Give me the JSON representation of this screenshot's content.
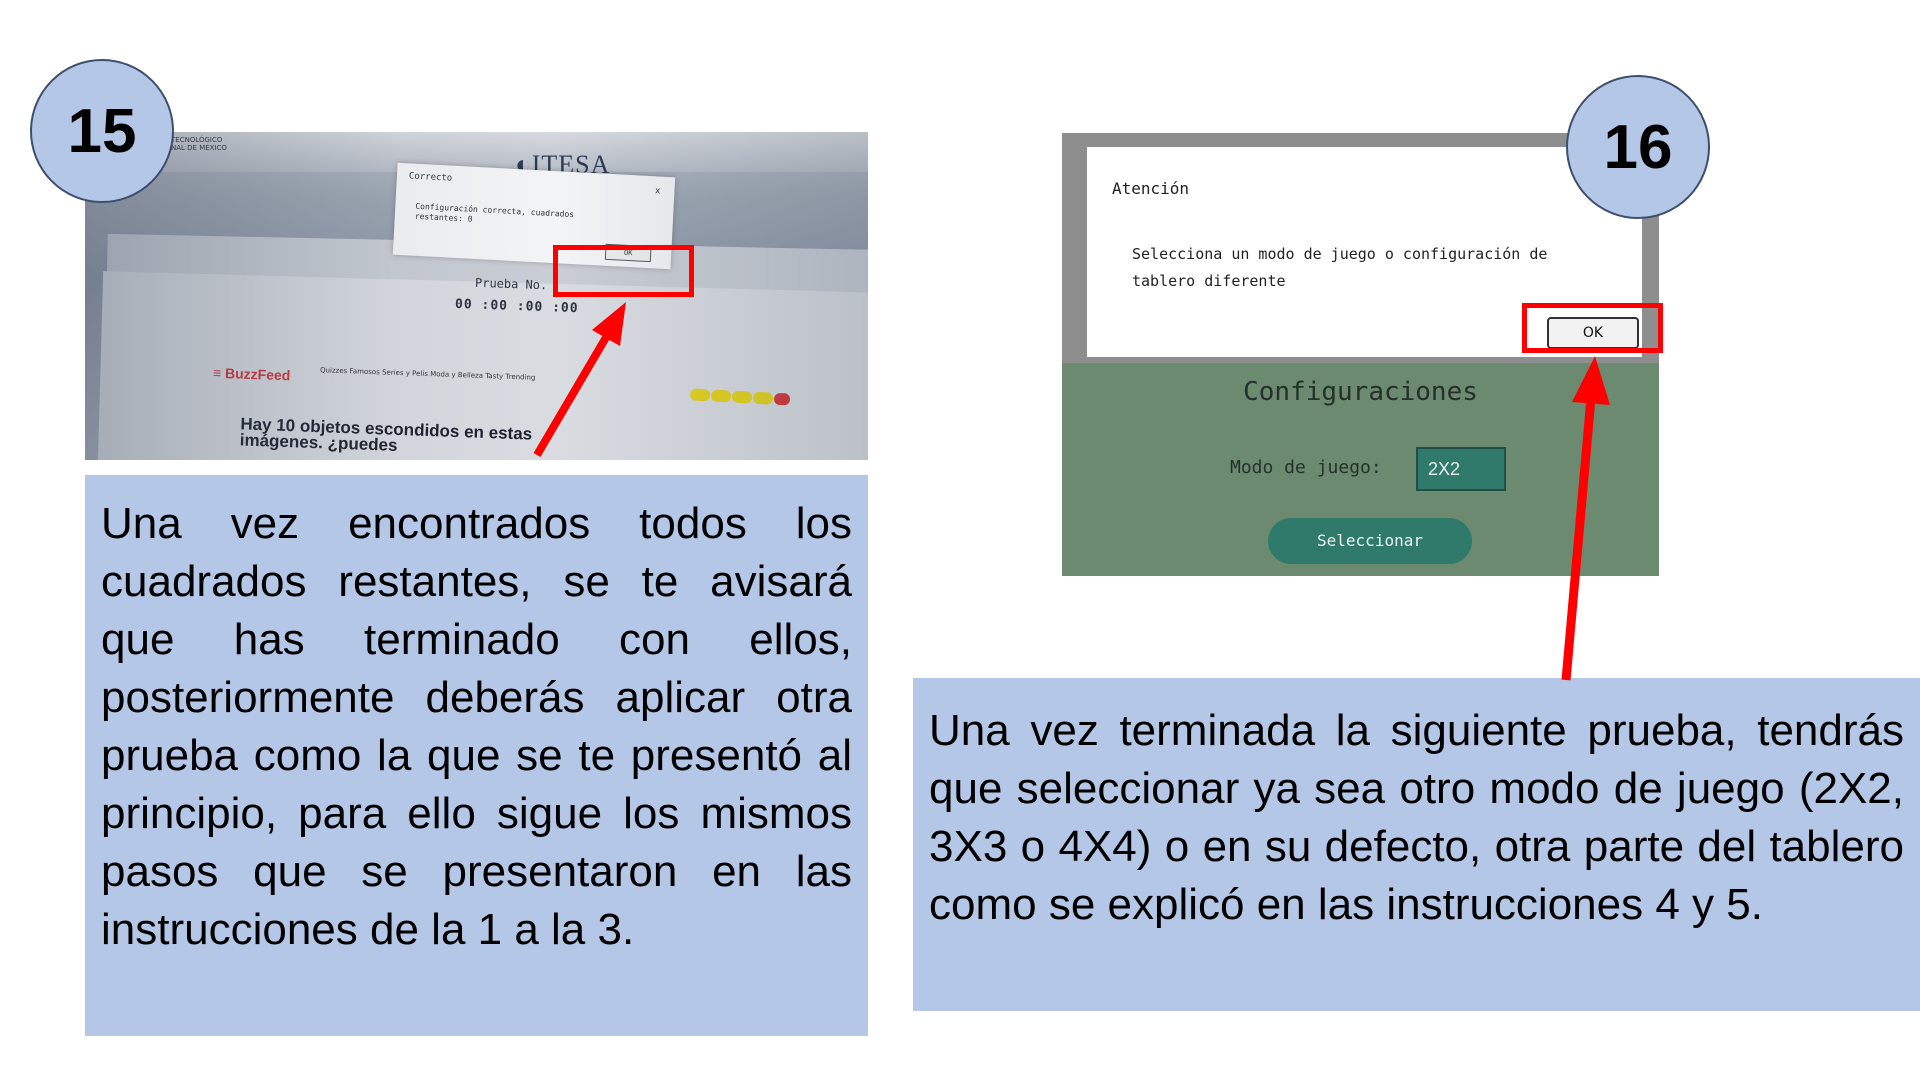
{
  "steps": [
    {
      "number": "15",
      "screenshot": {
        "logo_text": "ITESA",
        "logo_caption_line1": "TECNOLÓGICO",
        "logo_caption_line2": "NAL DE MÉXICO",
        "dialog_title": "Correcto",
        "dialog_close": "x",
        "dialog_message": "Configuración correcta, cuadrados restantes: 0",
        "dialog_ok": "OK",
        "prueba_label": "Prueba No.",
        "timer": "00 :00 :00 :00",
        "site_name": "BuzzFeed",
        "nav_items": "Quizzes   Famosos   Series y Pelis   Moda y Belleza   Tasty   Trending",
        "headline": "Hay 10 objetos escondidos en estas imágenes. ¿puedes"
      },
      "description": "Una vez encontrados todos los cuadrados restantes, se te avisará que has terminado con ellos, posteriormente deberás aplicar otra prueba como la que se te presentó al principio, para ello sigue los mismos pasos que se presentaron en las instrucciones de la 1 a la 3."
    },
    {
      "number": "16",
      "screenshot": {
        "dialog_title": "Atención",
        "dialog_message": "Selecciona un modo de juego o configuración de tablero diferente",
        "dialog_ok": "OK",
        "config_title": "Configuraciones",
        "mode_label": "Modo de juego:",
        "mode_value": "2X2",
        "select_button": "Seleccionar"
      },
      "description": "Una vez terminada la siguiente prueba, tendrás que seleccionar ya sea otro modo de juego (2X2, 3X3 o 4X4) o en su defecto, otra parte del tablero como se explicó en las instrucciones 4 y 5."
    }
  ],
  "colors": {
    "circle_fill": "#b4c7e7",
    "text_box_fill": "#b4c7e7",
    "highlight": "#ff0000",
    "config_panel": "#6b8a70",
    "button_teal": "#2f7a6a"
  }
}
